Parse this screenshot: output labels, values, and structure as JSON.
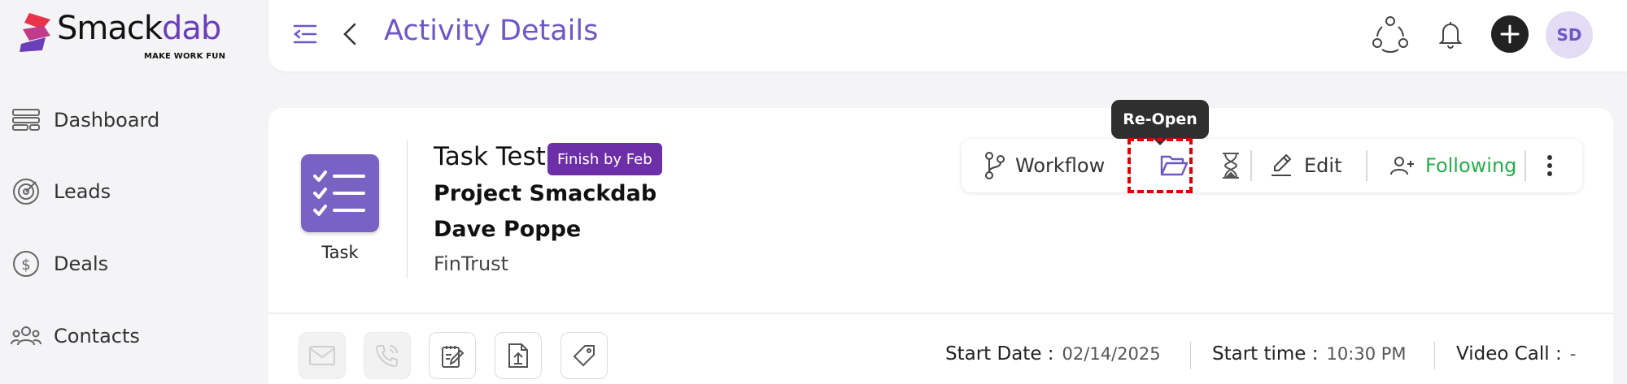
{
  "logo": {
    "name_a": "Smack",
    "name_b": "dab",
    "tagline": "MAKE WORK FUN"
  },
  "sidebar": {
    "items": [
      {
        "label": "Dashboard",
        "icon": "dashboard-icon"
      },
      {
        "label": "Leads",
        "icon": "target-icon"
      },
      {
        "label": "Deals",
        "icon": "dollar-icon"
      },
      {
        "label": "Contacts",
        "icon": "contacts-icon"
      }
    ]
  },
  "header": {
    "title": "Activity Details",
    "avatar_initials": "SD"
  },
  "activity": {
    "type_label": "Task",
    "title": "Task Test",
    "badge": "Finish by Feb",
    "project": "Project Smackdab",
    "contact": "Dave Poppe",
    "company": "FinTrust"
  },
  "toolbar": {
    "workflow_label": "Workflow",
    "edit_label": "Edit",
    "following_label": "Following",
    "tooltip": "Re-Open"
  },
  "meta": {
    "start_date_label": "Start Date :",
    "start_date": "02/14/2025",
    "start_time_label": "Start time :",
    "start_time": "10:30 PM",
    "video_call_label": "Video Call :",
    "video_call": "-"
  },
  "colors": {
    "accent": "#6e57c6",
    "badge": "#6d2fa8",
    "following": "#22b04b",
    "logo_red": "#e8334a"
  }
}
